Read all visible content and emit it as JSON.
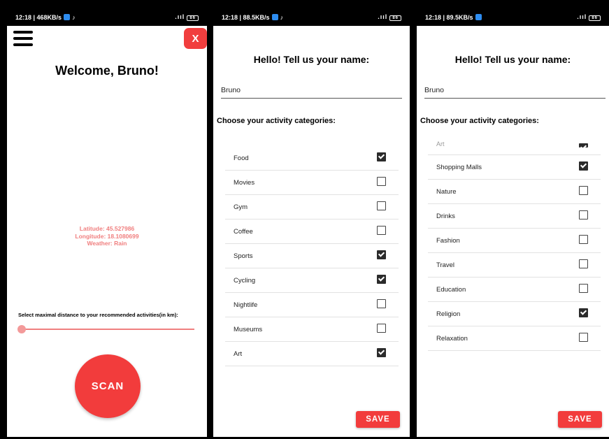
{
  "screens": [
    {
      "status": {
        "left": "12:18 | 468KB/s",
        "right": ".ııl",
        "battery": "86"
      },
      "close_label": "X",
      "welcome": "Welcome, Bruno!",
      "info": {
        "latitude": "Latitude: 45.527986",
        "longitude": "Longitude: 18.1080699",
        "weather": "Weather: Rain"
      },
      "distance_label": "Select maximal distance to your recommended activities(in km):",
      "distance_value": 0,
      "scan_label": "SCAN"
    },
    {
      "status": {
        "left": "12:18 | 88.5KB/s",
        "right": ".ııl",
        "battery": "86"
      },
      "title": "Hello! Tell us your name:",
      "name_value": "Bruno",
      "choose_label": "Choose your activity categories:",
      "categories": [
        {
          "label": "Food",
          "checked": true
        },
        {
          "label": "Movies",
          "checked": false
        },
        {
          "label": "Gym",
          "checked": false
        },
        {
          "label": "Coffee",
          "checked": false
        },
        {
          "label": "Sports",
          "checked": true
        },
        {
          "label": "Cycling",
          "checked": true
        },
        {
          "label": "Nightlife",
          "checked": false
        },
        {
          "label": "Museums",
          "checked": false
        },
        {
          "label": "Art",
          "checked": true
        }
      ],
      "save_label": "SAVE"
    },
    {
      "status": {
        "left": "12:18 | 89.5KB/s",
        "right": ".ııl",
        "battery": "86"
      },
      "title": "Hello! Tell us your name:",
      "name_value": "Bruno",
      "choose_label": "Choose your activity categories:",
      "partial_row": {
        "label": "Art",
        "checked": true
      },
      "categories": [
        {
          "label": "Shopping Malls",
          "checked": true
        },
        {
          "label": "Nature",
          "checked": false
        },
        {
          "label": "Drinks",
          "checked": false
        },
        {
          "label": "Fashion",
          "checked": false
        },
        {
          "label": "Travel",
          "checked": false
        },
        {
          "label": "Education",
          "checked": false
        },
        {
          "label": "Religion",
          "checked": true
        },
        {
          "label": "Relaxation",
          "checked": false
        }
      ],
      "save_label": "SAVE"
    }
  ],
  "colors": {
    "accent": "#f23c3c",
    "info_text": "#f07f7f",
    "checkbox": "#2b2b2b"
  },
  "icons": {
    "menu": "hamburger-icon",
    "checkbox": "checkbox-icon",
    "notification": "notification-icon"
  }
}
